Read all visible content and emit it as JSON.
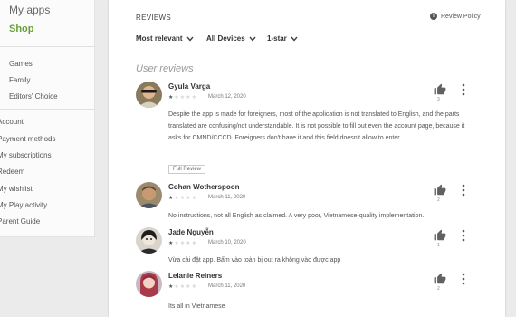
{
  "sidebar": {
    "my_apps": "My apps",
    "shop": "Shop",
    "categories": [
      "Games",
      "Family",
      "Editors' Choice"
    ],
    "account_links": [
      "Account",
      "Payment methods",
      "My subscriptions",
      "Redeem",
      "My wishlist",
      "My Play activity",
      "Parent Guide"
    ]
  },
  "header": {
    "title": "REVIEWS",
    "policy_label": "Review Policy",
    "policy_icon": "info-icon"
  },
  "filters": {
    "sort": "Most relevant",
    "devices": "All Devices",
    "rating": "1-star"
  },
  "section_label": "User reviews",
  "reviews": [
    {
      "name": "Gyula Varga",
      "rating": 1,
      "date": "March 12, 2020",
      "text": "Despite the app is made for foreigners, most of the application is not translated to English, and the parts translated are confusing/not understandable. It is not possible to fill out even the account page, because it asks for CMND/CCCD. Foreigners don't have it and this field doesn't allow to enter...",
      "full_review_label": "Full Review",
      "helpful_count": "3"
    },
    {
      "name": "Cohan Wotherspoon",
      "rating": 1,
      "date": "March 11, 2020",
      "text": "No instructions, not all English as claimed. A very poor, Vietnamese-quality implementation.",
      "helpful_count": "2"
    },
    {
      "name": "Jade Nguyễn",
      "rating": 1,
      "date": "March 10, 2020",
      "text": "Vừa cài đặt app. Bấm vào toàn bị out ra không vào được app",
      "helpful_count": "1"
    },
    {
      "name": "Lelanie Reiners",
      "rating": 1,
      "date": "March 11, 2020",
      "text": "Its all in Vietnamese",
      "helpful_count": "2"
    }
  ]
}
